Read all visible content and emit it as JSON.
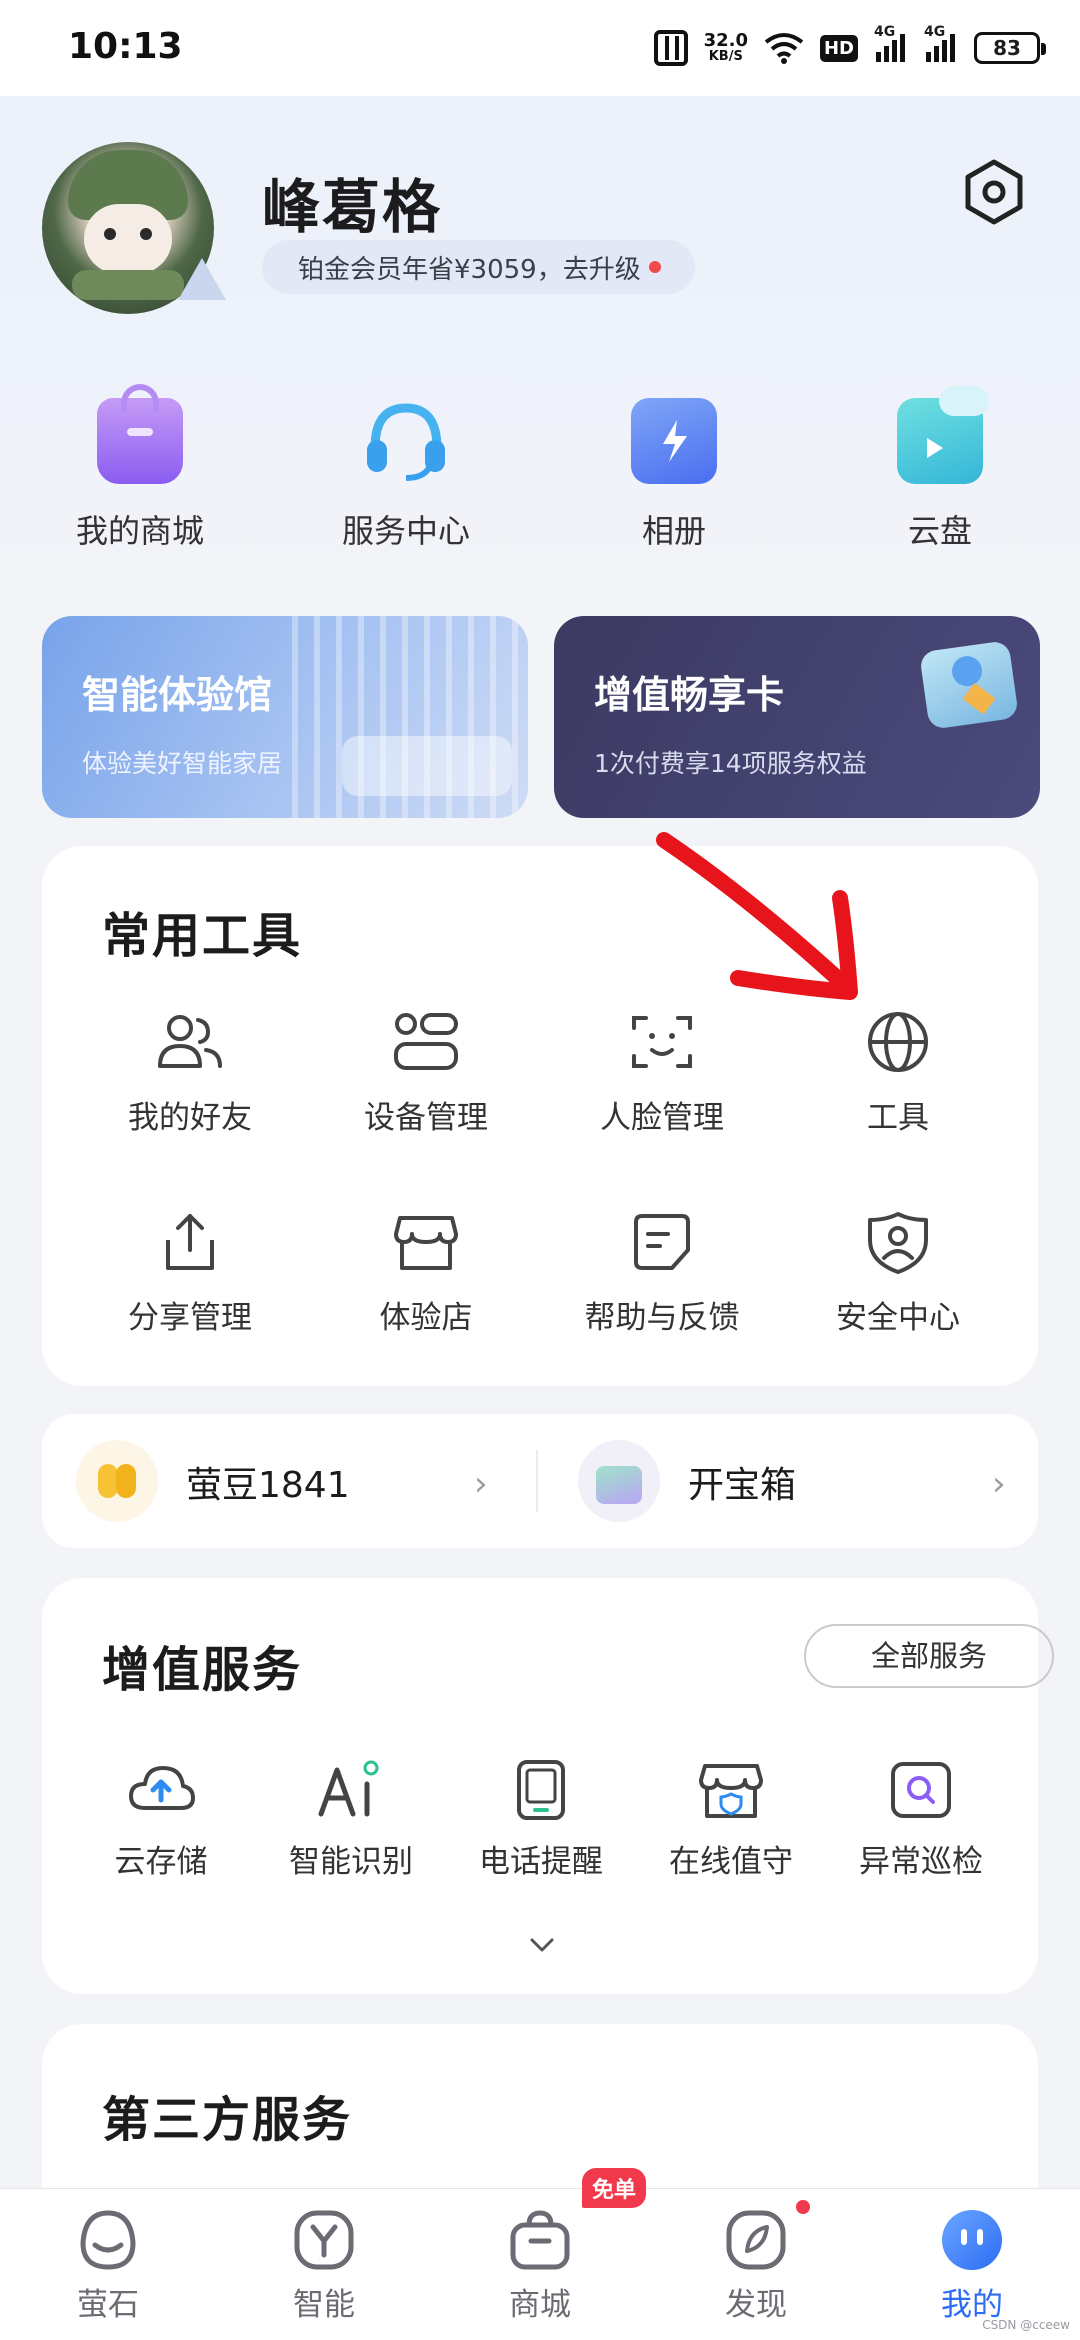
{
  "status_bar": {
    "time": "10:13",
    "speed_value": "32.0",
    "speed_unit": "KB/S",
    "hd_label": "HD",
    "net1": "4G",
    "net2": "4G",
    "battery": "83"
  },
  "profile": {
    "username": "峰葛格",
    "vip_text": "铂金会员年省¥3059，去升级"
  },
  "quick_entries": [
    {
      "label": "我的商城",
      "icon": "shopping-bag-icon"
    },
    {
      "label": "服务中心",
      "icon": "headset-icon"
    },
    {
      "label": "相册",
      "icon": "album-icon"
    },
    {
      "label": "云盘",
      "icon": "cloud-drive-icon"
    }
  ],
  "promos": [
    {
      "title": "智能体验馆",
      "subtitle": "体验美好智能家居"
    },
    {
      "title": "增值畅享卡",
      "subtitle": "1次付费享14项服务权益"
    }
  ],
  "common_tools": {
    "title": "常用工具",
    "items": [
      {
        "label": "我的好友",
        "icon": "friends-icon"
      },
      {
        "label": "设备管理",
        "icon": "device-management-icon"
      },
      {
        "label": "人脸管理",
        "icon": "face-scan-icon"
      },
      {
        "label": "工具",
        "icon": "globe-icon"
      },
      {
        "label": "分享管理",
        "icon": "share-icon"
      },
      {
        "label": "体验店",
        "icon": "store-icon"
      },
      {
        "label": "帮助与反馈",
        "icon": "feedback-icon"
      },
      {
        "label": "安全中心",
        "icon": "shield-user-icon"
      }
    ]
  },
  "rewards": {
    "beans_label": "萤豆1841",
    "treasure_label": "开宝箱"
  },
  "value_services": {
    "title": "增值服务",
    "all_label": "全部服务",
    "items": [
      {
        "label": "云存储",
        "icon": "cloud-upload-icon"
      },
      {
        "label": "智能识别",
        "icon": "ai-icon"
      },
      {
        "label": "电话提醒",
        "icon": "phone-icon"
      },
      {
        "label": "在线值守",
        "icon": "storefront-shield-icon"
      },
      {
        "label": "异常巡检",
        "icon": "search-scan-icon"
      }
    ]
  },
  "third_party": {
    "title": "第三方服务"
  },
  "bottom_nav": {
    "items": [
      {
        "label": "萤石",
        "icon": "home-icon"
      },
      {
        "label": "智能",
        "icon": "smart-icon"
      },
      {
        "label": "商城",
        "icon": "mall-bag-icon"
      },
      {
        "label": "发现",
        "icon": "discover-icon"
      },
      {
        "label": "我的",
        "icon": "profile-icon"
      }
    ],
    "active": "我的",
    "mall_badge": "免单"
  },
  "watermark": "CSDN @cceew",
  "colors": {
    "accent": "#2d6cf5",
    "badge_red": "#f0394a",
    "promo1_start": "#7ea7ea",
    "promo2_start": "#3e3e6a",
    "arrow_red": "#e8141b"
  }
}
